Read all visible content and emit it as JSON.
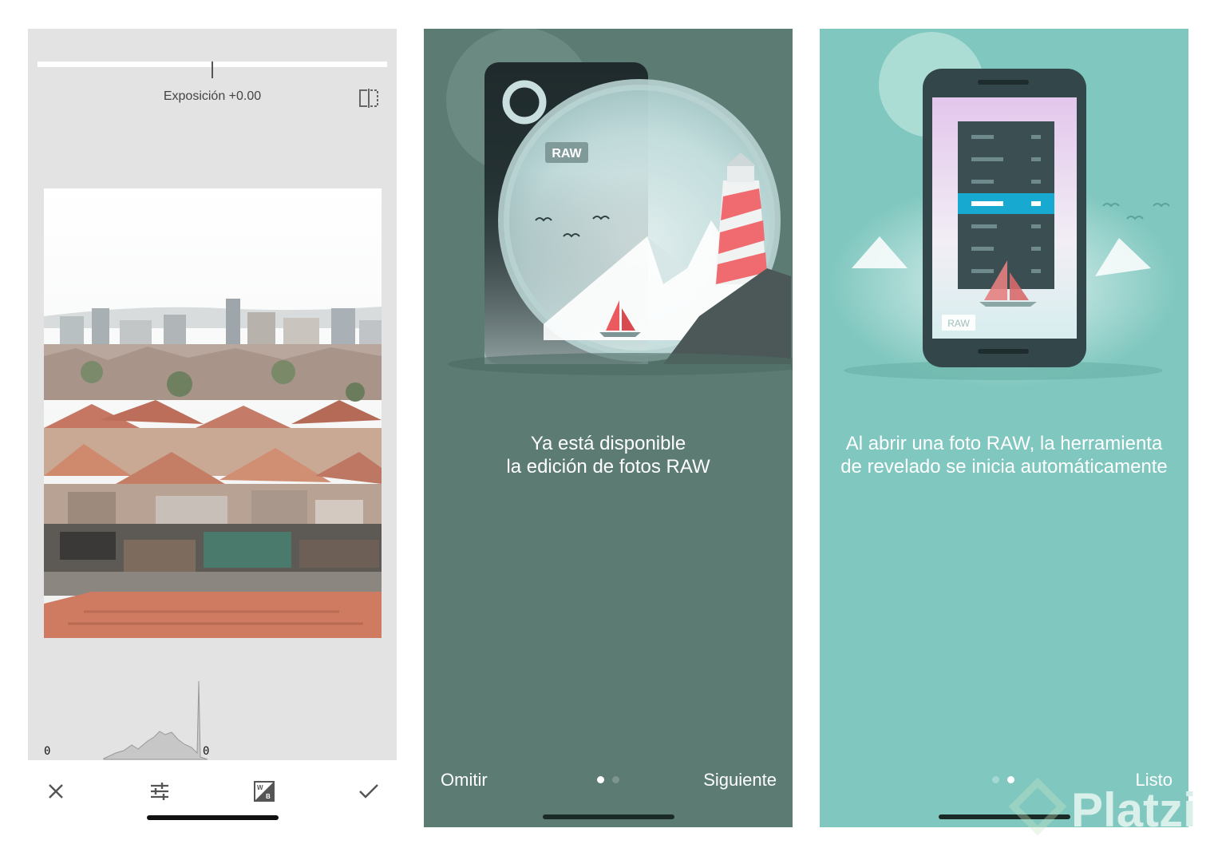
{
  "editor": {
    "parameter_label": "Exposición +0.00",
    "exposure_value": 0.0,
    "histogram_left_label": "0",
    "histogram_right_label": "0",
    "toolbar": {
      "cancel_icon": "close-icon",
      "adjust_icon": "sliders-icon",
      "white_balance_icon": "white-balance-icon",
      "apply_icon": "check-icon"
    }
  },
  "onboarding_1": {
    "badge": "RAW",
    "line1": "Ya está disponible",
    "line2": "la edición de fotos RAW",
    "skip_label": "Omitir",
    "next_label": "Siguiente",
    "page_index": 1,
    "page_count": 2,
    "background_color": "#5b7b73"
  },
  "onboarding_2": {
    "badge": "RAW",
    "line1": "Al abrir una foto RAW, la herramienta",
    "line2": "de revelado se inicia automáticamente",
    "done_label": "Listo",
    "page_index": 2,
    "page_count": 2,
    "background_color": "#7fc7bf"
  },
  "watermark": {
    "text": "Platzi"
  }
}
